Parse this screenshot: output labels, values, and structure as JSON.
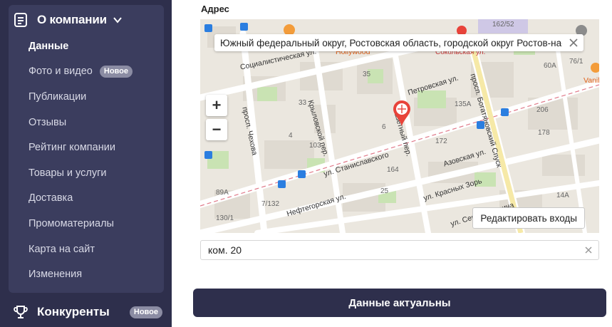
{
  "sidebar": {
    "section_title": "О компании",
    "section_icon": "document-icon",
    "items": [
      {
        "label": "Данные",
        "active": true
      },
      {
        "label": "Фото и видео",
        "badge": "Новое"
      },
      {
        "label": "Публикации"
      },
      {
        "label": "Отзывы"
      },
      {
        "label": "Рейтинг компании"
      },
      {
        "label": "Товары и услуги"
      },
      {
        "label": "Доставка"
      },
      {
        "label": "Промоматериалы"
      },
      {
        "label": "Карта на сайт"
      },
      {
        "label": "Изменения"
      }
    ],
    "competitors": {
      "label": "Конкуренты",
      "badge": "Новое",
      "icon": "trophy-icon"
    }
  },
  "main": {
    "address_label": "Адрес",
    "map": {
      "tooltip_text": "Южный федеральный округ, Ростовская область, городской округ Ростов-на-...",
      "edit_entrances_label": "Редактировать входы",
      "zoom_in": "+",
      "zoom_out": "−",
      "street_labels": {
        "s1": "Социалистическая ул.",
        "s2": "Крыловской пер.",
        "s3": "просп. Чехова",
        "s4": "ул. Станиславского",
        "s5": "Нефтегорская ул.",
        "s6": "Петровская ул.",
        "s7": "просп. Богатяновский Спуск",
        "s8": "Азовская ул.",
        "s9": "ул. Красных Зорь",
        "s10": "Газетный пер.",
        "s11": "ул. Серафимовича"
      },
      "poi_labels": {
        "p1": "Hollywood",
        "p2": "Сокольская ул.",
        "p3": "Vanil"
      },
      "house_numbers": {
        "h1": "35",
        "h2": "33",
        "h3": "4",
        "h4": "103",
        "h5": "6",
        "h6": "172",
        "h7": "164",
        "h8": "25",
        "h9": "7/132",
        "h10": "89А",
        "h11": "130/1",
        "h12": "135А",
        "h13": "60А",
        "h14": "76/1",
        "h15": "206",
        "h16": "178",
        "h17": "14А",
        "h18": "162/52"
      }
    },
    "room_input": {
      "value": "ком. 20"
    },
    "confirm_button": "Данные актуальны"
  },
  "colors": {
    "sidebar_bg": "#2e2f4c",
    "section_bg": "#3b3d5e",
    "badge_bg": "#8b8ca3",
    "pin_red": "#e8433a",
    "button_bg": "#2e2f4c"
  }
}
